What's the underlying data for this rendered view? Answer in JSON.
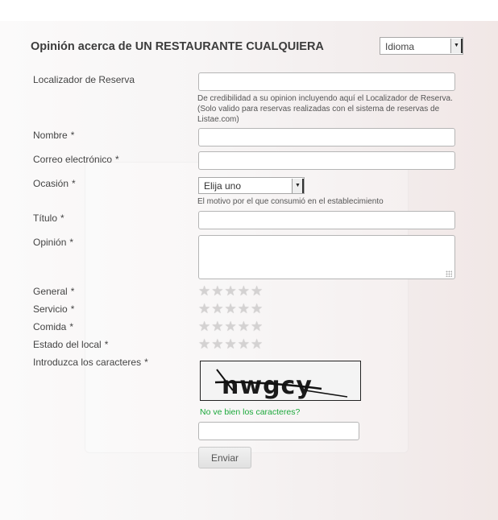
{
  "form": {
    "title": "Opinión acerca de UN RESTAURANTE CUALQUIERA",
    "language_select": "Idioma",
    "required_marker": "*",
    "fields": {
      "localizador": {
        "label": "Localizador de Reserva",
        "value": "",
        "hint": "De credibilidad a su opinion incluyendo aquí el Localizador de Reserva. (Solo valido para reservas realizadas con el sistema de reservas de Listae.com)"
      },
      "nombre": {
        "label": "Nombre",
        "value": ""
      },
      "correo": {
        "label": "Correo electrónico",
        "value": ""
      },
      "ocasion": {
        "label": "Ocasión",
        "selected": "Elija uno",
        "hint": "El motivo por el que consumió en el establecimiento"
      },
      "titulo": {
        "label": "Título",
        "value": ""
      },
      "opinion": {
        "label": "Opinión",
        "value": ""
      }
    },
    "ratings": [
      {
        "label": "General",
        "value": 0,
        "max": 5
      },
      {
        "label": "Servicio",
        "value": 0,
        "max": 5
      },
      {
        "label": "Comida",
        "value": 0,
        "max": 5
      },
      {
        "label": "Estado del local",
        "value": 0,
        "max": 5
      }
    ],
    "captcha": {
      "label": "Introduzca los caracteres",
      "image_text": "nwgcy",
      "refresh_link": "No ve bien los caracteres?",
      "value": ""
    },
    "submit_label": "Enviar"
  },
  "colors": {
    "link": "#1ca83b",
    "star_empty": "#d4d2d2",
    "text": "#444444"
  }
}
